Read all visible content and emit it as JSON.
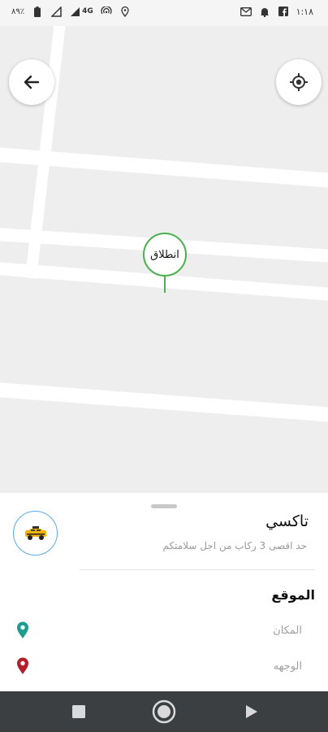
{
  "status_bar": {
    "time": "١:١٨",
    "battery": "٨٩٪",
    "network": "4G",
    "icons_left": [
      "battery-icon",
      "signal-icon",
      "wifi-icon",
      "hotspot-icon",
      "location-icon"
    ],
    "icons_right": [
      "gmail-icon",
      "notification-bell-icon",
      "facebook-icon"
    ]
  },
  "map": {
    "pin_label": "انطلاق",
    "pin_color": "#4caf50",
    "back_icon": "arrow-left-icon",
    "locate_icon": "crosshair-icon"
  },
  "service": {
    "title": "تاكسي",
    "subtitle": "حد اقصى 3 ركاب من اجل سلامتكم",
    "icon": "taxi-icon"
  },
  "location": {
    "title": "الموقع",
    "origin_label": "المكان",
    "origin_color": "#1e9c8f",
    "destination_label": "الوجهه",
    "destination_color": "#b3202a"
  },
  "nav_bar": {
    "icons": [
      "stop-icon",
      "home-icon",
      "play-icon"
    ]
  }
}
